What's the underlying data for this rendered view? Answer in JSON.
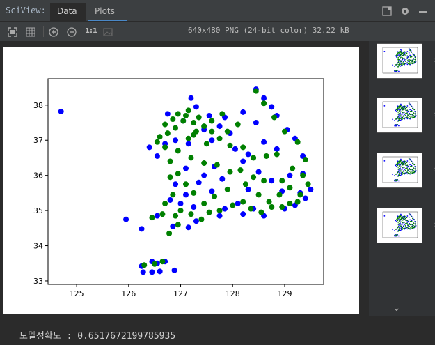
{
  "header": {
    "app_label": "SciView:",
    "tabs": [
      "Data",
      "Plots"
    ]
  },
  "toolbar": {
    "image_info": "640x480 PNG (24-bit color) 32.22 kB",
    "zoom_actual_label": "1:1"
  },
  "console": {
    "output": "모델정확도 : 0.6517672199785935"
  },
  "colors": {
    "series_a": "#0000ff",
    "series_b": "#008000",
    "accent": "#4a88c7"
  },
  "icons": [
    "fit-screen-icon",
    "grid-icon",
    "zoom-in-icon",
    "zoom-out-icon",
    "actual-size-icon",
    "background-icon",
    "layout-icon",
    "gear-icon",
    "minimize-icon",
    "chevron-right-icon",
    "chevron-down-icon"
  ],
  "chart_data": {
    "type": "scatter",
    "xlim": [
      124.45,
      129.75
    ],
    "ylim": [
      32.9,
      38.75
    ],
    "x_ticks": [
      125,
      126,
      127,
      128,
      129
    ],
    "y_ticks": [
      33,
      34,
      35,
      36,
      37,
      38
    ],
    "grid": false,
    "series": [
      {
        "color": "#0000ff",
        "points": [
          [
            124.7,
            37.82
          ],
          [
            125.95,
            34.75
          ],
          [
            126.25,
            34.48
          ],
          [
            126.25,
            33.42
          ],
          [
            126.28,
            33.25
          ],
          [
            126.45,
            33.25
          ],
          [
            126.6,
            33.27
          ],
          [
            126.88,
            33.3
          ],
          [
            126.45,
            33.55
          ],
          [
            126.55,
            33.5
          ],
          [
            126.7,
            33.55
          ],
          [
            126.55,
            34.85
          ],
          [
            126.85,
            34.55
          ],
          [
            127.15,
            34.52
          ],
          [
            127.3,
            34.7
          ],
          [
            127.25,
            35.1
          ],
          [
            127.0,
            35.2
          ],
          [
            126.8,
            35.3
          ],
          [
            126.9,
            35.75
          ],
          [
            127.1,
            35.45
          ],
          [
            127.45,
            36.0
          ],
          [
            127.65,
            36.25
          ],
          [
            127.8,
            35.9
          ],
          [
            127.6,
            35.55
          ],
          [
            127.35,
            35.8
          ],
          [
            127.1,
            36.2
          ],
          [
            126.55,
            36.55
          ],
          [
            126.4,
            36.8
          ],
          [
            126.75,
            37.75
          ],
          [
            127.2,
            38.2
          ],
          [
            127.3,
            37.95
          ],
          [
            127.55,
            37.7
          ],
          [
            127.75,
            37.4
          ],
          [
            127.95,
            37.2
          ],
          [
            128.05,
            36.75
          ],
          [
            128.2,
            36.4
          ],
          [
            128.45,
            38.45
          ],
          [
            128.6,
            38.2
          ],
          [
            128.75,
            37.95
          ],
          [
            128.85,
            37.7
          ],
          [
            129.05,
            37.3
          ],
          [
            129.2,
            37.05
          ],
          [
            129.35,
            36.55
          ],
          [
            129.35,
            36.05
          ],
          [
            129.5,
            35.6
          ],
          [
            129.4,
            35.35
          ],
          [
            129.2,
            35.15
          ],
          [
            129.0,
            35.05
          ],
          [
            128.6,
            34.85
          ],
          [
            128.4,
            35.05
          ],
          [
            128.1,
            35.2
          ],
          [
            127.85,
            35.05
          ],
          [
            127.75,
            34.85
          ],
          [
            128.2,
            34.9
          ],
          [
            128.75,
            35.85
          ],
          [
            128.5,
            36.1
          ],
          [
            128.95,
            35.55
          ],
          [
            129.3,
            35.5
          ],
          [
            129.1,
            36.0
          ],
          [
            128.3,
            35.6
          ],
          [
            127.05,
            37.55
          ],
          [
            127.45,
            37.3
          ],
          [
            127.6,
            37.0
          ],
          [
            127.15,
            36.9
          ],
          [
            126.9,
            37.0
          ],
          [
            126.7,
            36.9
          ],
          [
            128.45,
            37.5
          ],
          [
            128.2,
            37.8
          ],
          [
            127.85,
            37.65
          ],
          [
            128.6,
            36.95
          ],
          [
            128.3,
            36.6
          ],
          [
            128.85,
            36.75
          ]
        ]
      },
      {
        "color": "#008000",
        "points": [
          [
            126.3,
            33.45
          ],
          [
            126.5,
            33.48
          ],
          [
            126.65,
            33.55
          ],
          [
            126.45,
            34.8
          ],
          [
            126.65,
            34.9
          ],
          [
            126.78,
            34.35
          ],
          [
            126.9,
            34.85
          ],
          [
            127.0,
            35.0
          ],
          [
            127.2,
            34.9
          ],
          [
            127.4,
            34.75
          ],
          [
            127.55,
            34.95
          ],
          [
            127.75,
            35.0
          ],
          [
            128.0,
            35.15
          ],
          [
            128.2,
            35.25
          ],
          [
            128.35,
            35.05
          ],
          [
            128.55,
            34.95
          ],
          [
            128.75,
            35.1
          ],
          [
            128.95,
            35.1
          ],
          [
            129.1,
            35.2
          ],
          [
            129.25,
            35.25
          ],
          [
            129.3,
            35.45
          ],
          [
            129.45,
            35.75
          ],
          [
            129.35,
            36.0
          ],
          [
            129.15,
            36.2
          ],
          [
            128.95,
            35.85
          ],
          [
            128.6,
            35.85
          ],
          [
            128.4,
            35.95
          ],
          [
            128.15,
            36.15
          ],
          [
            127.95,
            36.1
          ],
          [
            127.7,
            36.3
          ],
          [
            127.45,
            36.35
          ],
          [
            127.2,
            36.5
          ],
          [
            126.95,
            36.7
          ],
          [
            126.7,
            36.8
          ],
          [
            126.55,
            36.95
          ],
          [
            126.75,
            37.2
          ],
          [
            126.9,
            37.35
          ],
          [
            127.05,
            37.55
          ],
          [
            127.1,
            37.7
          ],
          [
            127.25,
            37.5
          ],
          [
            127.45,
            37.4
          ],
          [
            127.6,
            37.25
          ],
          [
            127.75,
            37.05
          ],
          [
            127.5,
            36.9
          ],
          [
            127.25,
            37.15
          ],
          [
            126.85,
            37.6
          ],
          [
            126.7,
            37.45
          ],
          [
            126.95,
            37.75
          ],
          [
            127.15,
            37.85
          ],
          [
            127.35,
            37.65
          ],
          [
            127.8,
            37.75
          ],
          [
            128.1,
            37.45
          ],
          [
            128.45,
            38.4
          ],
          [
            128.6,
            38.05
          ],
          [
            128.8,
            37.65
          ],
          [
            129.0,
            37.25
          ],
          [
            129.25,
            36.95
          ],
          [
            129.4,
            36.45
          ],
          [
            128.85,
            36.6
          ],
          [
            128.65,
            36.55
          ],
          [
            128.4,
            36.5
          ],
          [
            128.2,
            36.8
          ],
          [
            127.95,
            36.85
          ],
          [
            127.9,
            37.25
          ],
          [
            126.95,
            36.05
          ],
          [
            126.8,
            35.95
          ],
          [
            127.1,
            35.75
          ],
          [
            127.25,
            35.5
          ],
          [
            126.85,
            35.45
          ],
          [
            126.7,
            35.2
          ],
          [
            127.45,
            35.2
          ],
          [
            127.65,
            35.4
          ],
          [
            127.9,
            35.6
          ],
          [
            128.25,
            35.75
          ],
          [
            128.5,
            35.45
          ],
          [
            128.7,
            35.25
          ],
          [
            128.9,
            35.45
          ],
          [
            129.1,
            35.65
          ],
          [
            126.95,
            34.6
          ],
          [
            126.8,
            36.4
          ],
          [
            127.3,
            37.25
          ],
          [
            127.6,
            37.55
          ],
          [
            127.15,
            37.05
          ],
          [
            126.6,
            37.1
          ]
        ]
      }
    ]
  }
}
